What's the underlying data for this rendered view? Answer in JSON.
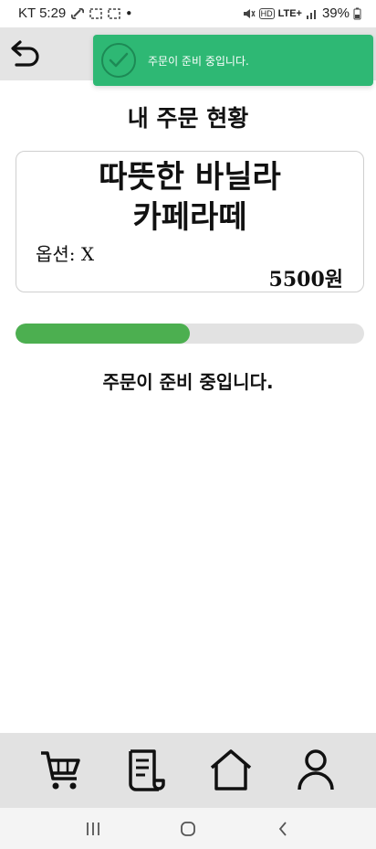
{
  "status_bar": {
    "carrier_time": "KT 5:29",
    "network": "LTE+",
    "battery": "39%"
  },
  "header": {
    "back_icon": "back-arrow-icon"
  },
  "toast": {
    "message": "주문이 준비 중입니다.",
    "icon": "check-circle-icon",
    "color": "#2eb874"
  },
  "page": {
    "title": "내 주문 현황"
  },
  "order": {
    "product_line1": "따뜻한 바닐라",
    "product_line2": "카페라떼",
    "option": "옵션: X",
    "price": "5500원"
  },
  "progress": {
    "fraction": 0.5,
    "color": "#4caf50",
    "status_text": "주문이 준비 중입니다."
  },
  "bottom_nav": {
    "items": [
      {
        "icon": "cart-icon"
      },
      {
        "icon": "receipt-icon"
      },
      {
        "icon": "home-icon"
      },
      {
        "icon": "profile-icon"
      }
    ]
  },
  "system_nav": {
    "items": [
      "recent-apps-icon",
      "home-circle-icon",
      "back-chevron-icon"
    ]
  }
}
